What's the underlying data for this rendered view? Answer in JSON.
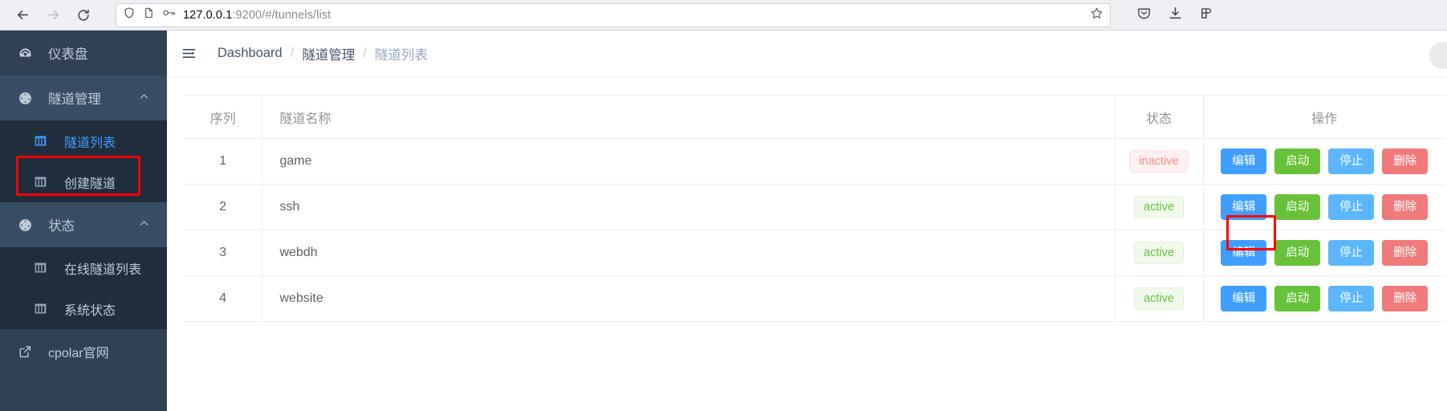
{
  "browser": {
    "back_icon": "back-arrow-icon",
    "forward_icon": "forward-arrow-icon",
    "reload_icon": "reload-icon",
    "shield_icon": "shield-icon",
    "page_icon": "page-info-icon",
    "key_icon": "password-key-icon",
    "url_host": "127.0.0.1",
    "url_path": ":9200/#/tunnels/list",
    "url_full": "127.0.0.1:9200/#/tunnels/list",
    "bookmark_icon": "star-bookmark-icon",
    "pocket_icon": "pocket-save-icon",
    "download_icon": "downloads-icon",
    "extension_icon": "extensions-icon"
  },
  "sidebar": {
    "items": [
      {
        "label": "仪表盘",
        "icon": "dashboard-gauge-icon",
        "type": "item"
      },
      {
        "label": "隧道管理",
        "icon": "tunnel-manage-icon",
        "type": "group",
        "caret": "chevron-up-icon",
        "open": true
      },
      {
        "label": "隧道列表",
        "icon": "table-grid-icon",
        "type": "sub",
        "active": true
      },
      {
        "label": "创建隧道",
        "icon": "table-grid-icon",
        "type": "sub",
        "active": false
      },
      {
        "label": "状态",
        "icon": "status-circle-icon",
        "type": "group",
        "caret": "chevron-up-icon",
        "open": true
      },
      {
        "label": "在线隧道列表",
        "icon": "table-grid-icon",
        "type": "sub",
        "active": false
      },
      {
        "label": "系统状态",
        "icon": "table-grid-icon",
        "type": "sub",
        "active": false
      }
    ],
    "external_link": {
      "label": "cpolar官网",
      "icon": "external-link-icon"
    }
  },
  "topbar": {
    "hamburger_icon": "collapse-menu-icon",
    "breadcrumb": [
      {
        "label": "Dashboard",
        "current": false
      },
      {
        "label": "隧道管理",
        "current": false
      },
      {
        "label": "隧道列表",
        "current": true
      }
    ],
    "separator": "/"
  },
  "table": {
    "columns": [
      {
        "key": "seq",
        "label": "序列"
      },
      {
        "key": "name",
        "label": "隧道名称"
      },
      {
        "key": "state",
        "label": "状态"
      },
      {
        "key": "ops",
        "label": "操作"
      }
    ],
    "rows": [
      {
        "seq": "1",
        "name": "game",
        "state": "inactive",
        "state_kind": "inactive"
      },
      {
        "seq": "2",
        "name": "ssh",
        "state": "active",
        "state_kind": "active"
      },
      {
        "seq": "3",
        "name": "webdh",
        "state": "active",
        "state_kind": "active"
      },
      {
        "seq": "4",
        "name": "website",
        "state": "active",
        "state_kind": "active"
      }
    ],
    "actions": [
      {
        "label": "编辑",
        "kind": "edit"
      },
      {
        "label": "启动",
        "kind": "start"
      },
      {
        "label": "停止",
        "kind": "stop"
      },
      {
        "label": "删除",
        "kind": "delete"
      }
    ]
  },
  "highlights": [
    {
      "name": "sidebar-tunnel-list-highlight",
      "color": "#ff0000"
    },
    {
      "name": "row3-edit-button-highlight",
      "color": "#ff0000"
    }
  ],
  "colors": {
    "sidebar_bg": "#304156",
    "sidebar_sub_bg": "#1f2d3d",
    "accent_blue": "#409eff",
    "success_green": "#67c23a",
    "danger_red": "#f07a7a",
    "highlight_red": "#ff0000"
  }
}
